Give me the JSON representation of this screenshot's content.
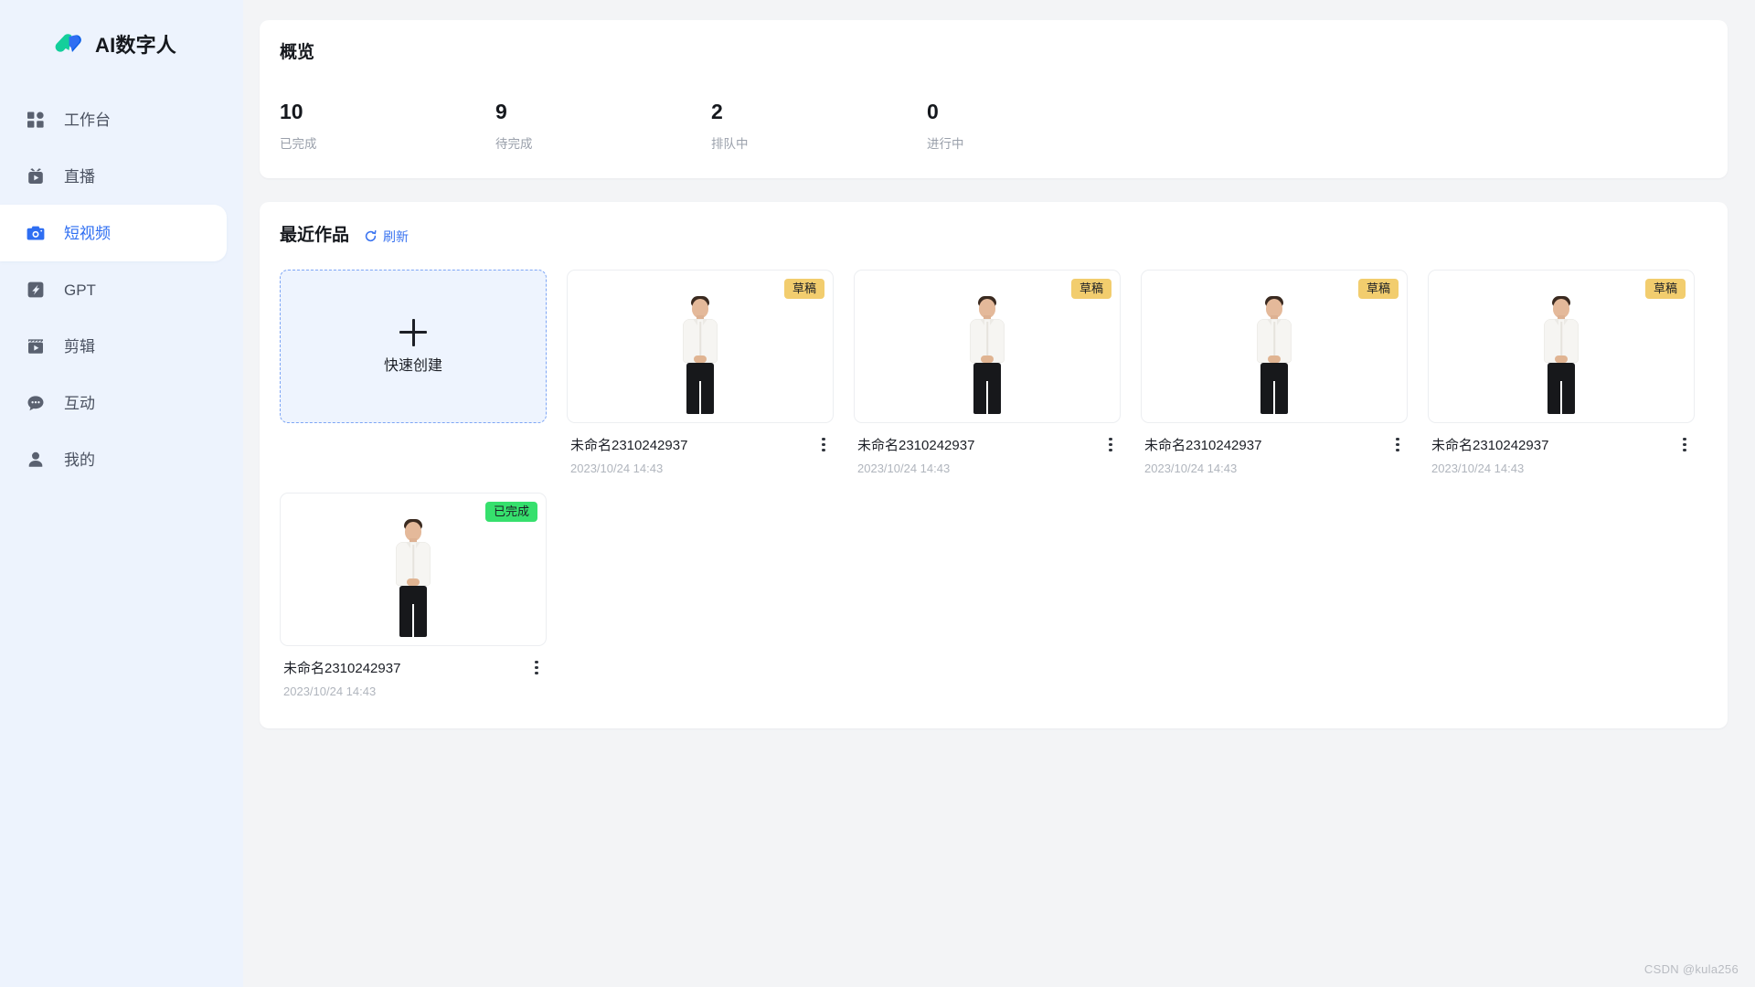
{
  "brand": {
    "name": "AI数字人",
    "logo_icon": "brand-logo-icon"
  },
  "sidebar": {
    "items": [
      {
        "label": "工作台",
        "icon": "grid-icon",
        "active": false
      },
      {
        "label": "直播",
        "icon": "tv-play-icon",
        "active": false
      },
      {
        "label": "短视频",
        "icon": "camera-icon",
        "active": true
      },
      {
        "label": "GPT",
        "icon": "sparkle-box-icon",
        "active": false
      },
      {
        "label": "剪辑",
        "icon": "clapperboard-icon",
        "active": false
      },
      {
        "label": "互动",
        "icon": "chat-bubble-icon",
        "active": false
      },
      {
        "label": "我的",
        "icon": "user-icon",
        "active": false
      }
    ]
  },
  "overview": {
    "title": "概览",
    "stats": [
      {
        "value": "10",
        "label": "已完成"
      },
      {
        "value": "9",
        "label": "待完成"
      },
      {
        "value": "2",
        "label": "排队中"
      },
      {
        "value": "0",
        "label": "进行中"
      }
    ]
  },
  "works": {
    "title": "最近作品",
    "refresh_label": "刷新",
    "refresh_icon": "refresh-icon",
    "create_card": {
      "label": "快速创建",
      "icon": "plus-icon"
    },
    "menu_icon": "more-vertical-icon",
    "items": [
      {
        "title": "未命名2310242937",
        "time": "2023/10/24 14:43",
        "badge": "草稿",
        "badge_type": "draft"
      },
      {
        "title": "未命名2310242937",
        "time": "2023/10/24 14:43",
        "badge": "草稿",
        "badge_type": "draft"
      },
      {
        "title": "未命名2310242937",
        "time": "2023/10/24 14:43",
        "badge": "草稿",
        "badge_type": "draft"
      },
      {
        "title": "未命名2310242937",
        "time": "2023/10/24 14:43",
        "badge": "草稿",
        "badge_type": "draft"
      },
      {
        "title": "未命名2310242937",
        "time": "2023/10/24 14:43",
        "badge": "已完成",
        "badge_type": "done"
      }
    ]
  },
  "watermark": "CSDN @kula256",
  "colors": {
    "accent": "#2e6ef2",
    "sidebar_bg": "#edf3fd",
    "page_bg": "#f3f4f6",
    "badge_draft": "#f2cd6e",
    "badge_done": "#36e06d",
    "text_primary": "#15181d",
    "text_muted": "#9aa0ab"
  }
}
